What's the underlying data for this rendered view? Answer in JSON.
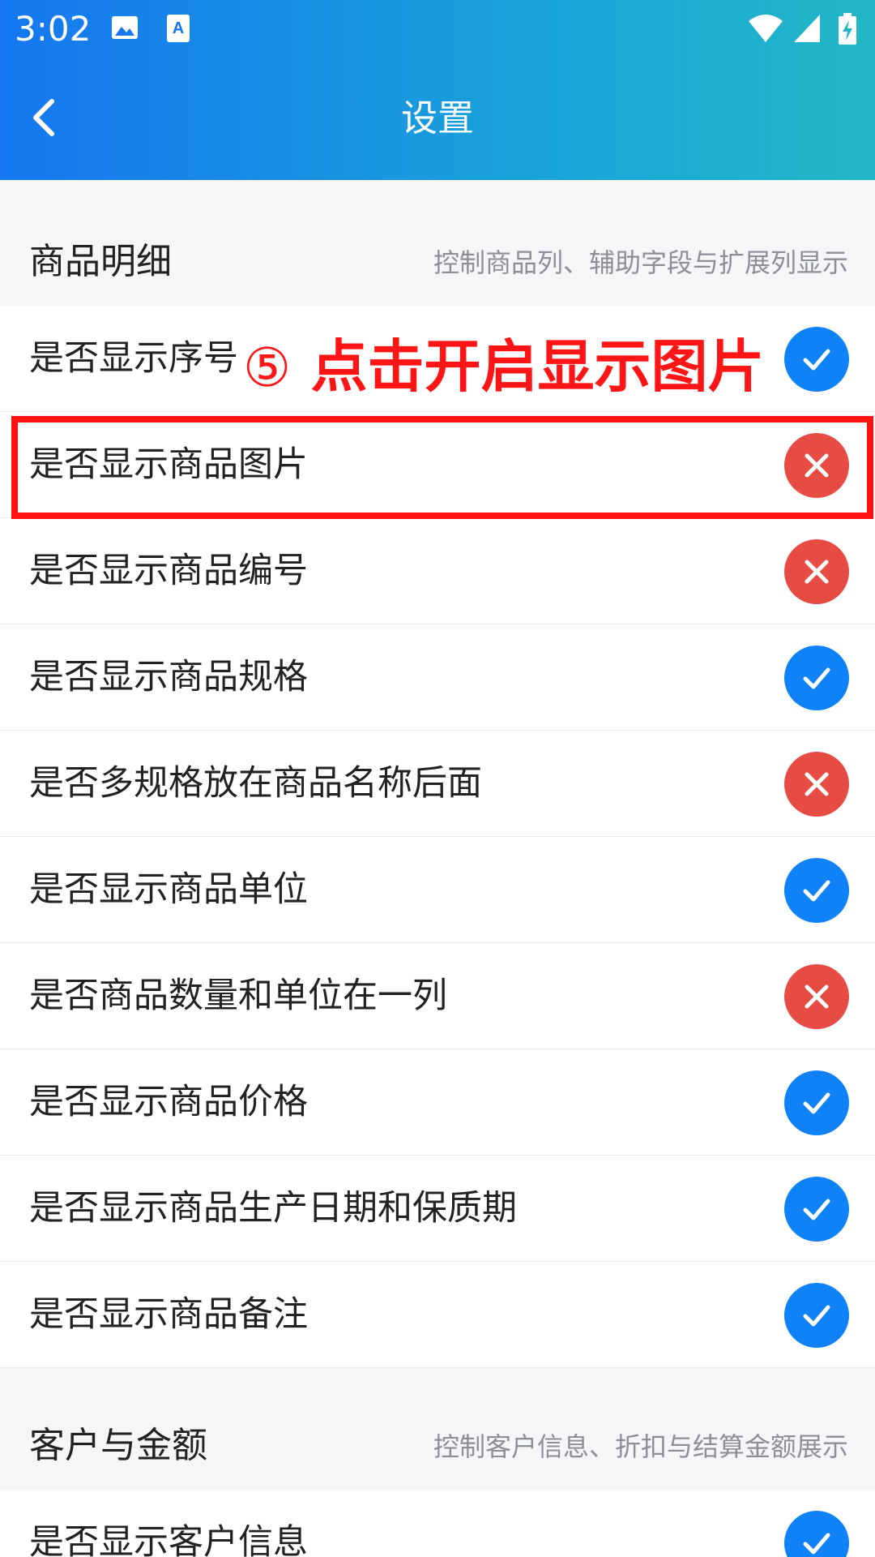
{
  "status_bar": {
    "time": "3:02",
    "icons": [
      "image-icon",
      "a-icon",
      "wifi-icon",
      "signal-icon",
      "battery-charging-icon"
    ]
  },
  "header": {
    "title": "设置",
    "back_icon": "chevron-left-icon",
    "background_gradient": [
      "#1677f0",
      "#22b7c6"
    ]
  },
  "annotation": {
    "step": "⑤",
    "text": "点击开启显示图片",
    "color": "#ff1515"
  },
  "sections": [
    {
      "title": "商品明细",
      "description": "控制商品列、辅助字段与扩展列显示",
      "items": [
        {
          "label": "是否显示序号",
          "enabled": true
        },
        {
          "label": "是否显示商品图片",
          "enabled": false
        },
        {
          "label": "是否显示商品编号",
          "enabled": false
        },
        {
          "label": "是否显示商品规格",
          "enabled": true
        },
        {
          "label": "是否多规格放在商品名称后面",
          "enabled": false
        },
        {
          "label": "是否显示商品单位",
          "enabled": true
        },
        {
          "label": "是否商品数量和单位在一列",
          "enabled": false
        },
        {
          "label": "是否显示商品价格",
          "enabled": true
        },
        {
          "label": "是否显示商品生产日期和保质期",
          "enabled": true
        },
        {
          "label": "是否显示商品备注",
          "enabled": true
        }
      ]
    },
    {
      "title": "客户与金额",
      "description": "控制客户信息、折扣与结算金额展示",
      "items": [
        {
          "label": "是否显示客户信息",
          "enabled": true
        }
      ]
    }
  ],
  "colors": {
    "on": "#0e82f6",
    "off": "#e74c44"
  }
}
